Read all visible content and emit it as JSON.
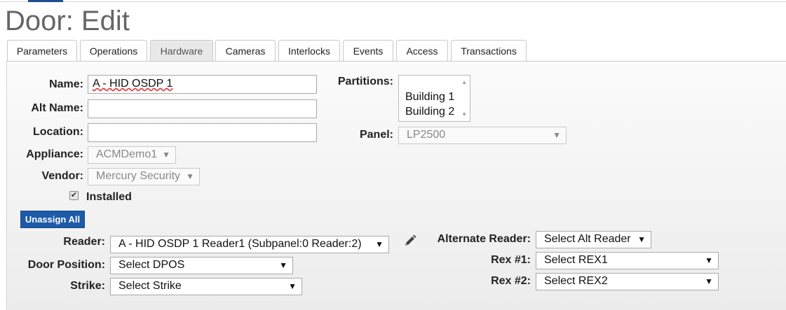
{
  "page": {
    "title": "Door: Edit"
  },
  "tabs": [
    {
      "label": "Parameters"
    },
    {
      "label": "Operations"
    },
    {
      "label": "Hardware",
      "active": true
    },
    {
      "label": "Cameras"
    },
    {
      "label": "Interlocks"
    },
    {
      "label": "Events"
    },
    {
      "label": "Access"
    },
    {
      "label": "Transactions"
    }
  ],
  "form": {
    "name": {
      "label": "Name:",
      "value": "A - HID OSDP 1"
    },
    "alt_name": {
      "label": "Alt Name:",
      "value": ""
    },
    "location": {
      "label": "Location:",
      "value": ""
    },
    "appliance": {
      "label": "Appliance:",
      "value": "ACMDemo1"
    },
    "vendor": {
      "label": "Vendor:",
      "value": "Mercury Security"
    },
    "installed": {
      "label": "Installed",
      "checked": true
    },
    "partitions": {
      "label": "Partitions:",
      "options": [
        "Building 1",
        "Building 2"
      ]
    },
    "panel": {
      "label": "Panel:",
      "value": "LP2500"
    }
  },
  "hardware": {
    "unassign_label": "Unassign All",
    "reader": {
      "label": "Reader:",
      "value": "A - HID OSDP 1 Reader1 (Subpanel:0 Reader:2)"
    },
    "door_position": {
      "label": "Door Position:",
      "value": "Select DPOS"
    },
    "strike": {
      "label": "Strike:",
      "value": "Select Strike"
    },
    "alternate_reader": {
      "label": "Alternate Reader:",
      "value": "Select Alt Reader"
    },
    "rex1": {
      "label": "Rex #1:",
      "value": "Select REX1"
    },
    "rex2": {
      "label": "Rex #2:",
      "value": "Select REX2"
    }
  },
  "icons": {
    "caret": "caret-down-icon",
    "edit": "pencil-icon",
    "check": "checkmark-icon"
  }
}
